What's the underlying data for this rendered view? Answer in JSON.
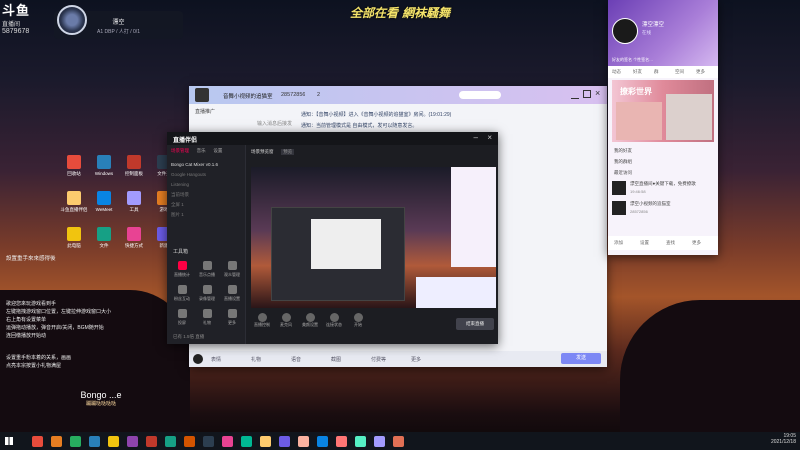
{
  "stream_logo": {
    "top": "斗鱼",
    "sub": "直播间",
    "room": "5879678"
  },
  "banner": "全部在看  網袜騷舞",
  "music_widget": {
    "title": "漂空",
    "sub": "A1 DBP / 人打 / 0/1"
  },
  "stream_caption": {
    "title": "Bongo ...e",
    "sub": "蹦蹦哒哒哒哒"
  },
  "desktop_notes": [
    "設置重手來來感得後",
    "歌迎您來玩游戏看到手",
    "左键拖拽游戏窗口位置，左键拉伸游戏窗口大小",
    "右上角有设置菜单",
    "运弹拖动播放，弹音开启/关闭，BGM随开始",
    "连回缴播放开始动"
  ],
  "desktop_notes2": [
    "设置重手粉本着的关系，画画",
    "点亮本宗按置小礼物满屋"
  ],
  "desktop_icons": [
    {
      "label": "回收站"
    },
    {
      "label": "Windows"
    },
    {
      "label": "控制面板"
    },
    {
      "label": "文件夹"
    },
    {
      "label": "斗鱼直播伴侣"
    },
    {
      "label": "WeMeet"
    },
    {
      "label": "工具"
    },
    {
      "label": "游戏"
    },
    {
      "label": "此电脑"
    },
    {
      "label": "文件"
    },
    {
      "label": "快捷方式"
    },
    {
      "label": "新建"
    }
  ],
  "chat_window": {
    "title": "音舞小视频的追猫室",
    "room_id": "28572856",
    "members": "2",
    "tabs": [
      "直播推广",
      "直播",
      "粉丝管理"
    ],
    "hint": "输入消息后接发",
    "messages": [
      "通知：【音舞小视频】进入《音舞小视频的追猫室》房间。(19:01:29)",
      "通知：当前管理模式是 自由模式，发可以随意发言。"
    ],
    "bottom_tools": [
      "表情",
      "礼物",
      "语音",
      "截图",
      "付费等",
      "更多"
    ],
    "send_label": "发送"
  },
  "streamer_app": {
    "title": "直播伴侣",
    "scene_tabs": [
      "场景管理",
      "音乐",
      "设置"
    ],
    "sources": [
      "Bongo Cat Mixer v0.1.6",
      "Google Hangouts",
      "Listening",
      "当前场景",
      "全屏 1",
      "图片 1"
    ],
    "tools_label": "工具箱",
    "tools": [
      "直播统计",
      "音乐点播",
      "观众管理",
      "粉丝互动",
      "录像管理",
      "直播设置",
      "投屏",
      "礼物",
      "更多"
    ],
    "preview_tabs": [
      "场景预览窗",
      "预览"
    ],
    "status": "正在直播中",
    "controls": [
      "直播控制",
      "麦克风",
      "美颜设置",
      "连接状态",
      "开始"
    ],
    "footer": "已有 1.5倍 直播",
    "end_btn": "结束直播"
  },
  "profile_panel": {
    "name": "漂空漂空",
    "status": "在线",
    "sign": "好友的签名 个性签名…",
    "nav": [
      "动态",
      "好友",
      "群",
      "空间",
      "更多"
    ],
    "banner_title": "撩彩世界",
    "list": [
      {
        "name": "我的好友"
      },
      {
        "name": "我的群组"
      },
      {
        "name": "最近访问"
      },
      {
        "name": "漂空直播间●关键下载，免费撩歌",
        "sub": "19:46:58"
      },
      {
        "name": "漂空小视频的追猫室",
        "sub": "28572856"
      }
    ],
    "footer": [
      "添加",
      "设置",
      "查找",
      "更多"
    ]
  },
  "clock": {
    "time": "19:05",
    "date": "2021/12/18"
  },
  "taskbar_colors": [
    "#e74c3c",
    "#e67e22",
    "#27ae60",
    "#2980b9",
    "#f1c40f",
    "#8e44ad",
    "#c0392b",
    "#16a085",
    "#d35400",
    "#2c3e50",
    "#e84393",
    "#00b894",
    "#fdcb6e",
    "#6c5ce7",
    "#fab1a0",
    "#0984e3",
    "#ff7675",
    "#55efc4",
    "#a29bfe",
    "#e17055"
  ]
}
